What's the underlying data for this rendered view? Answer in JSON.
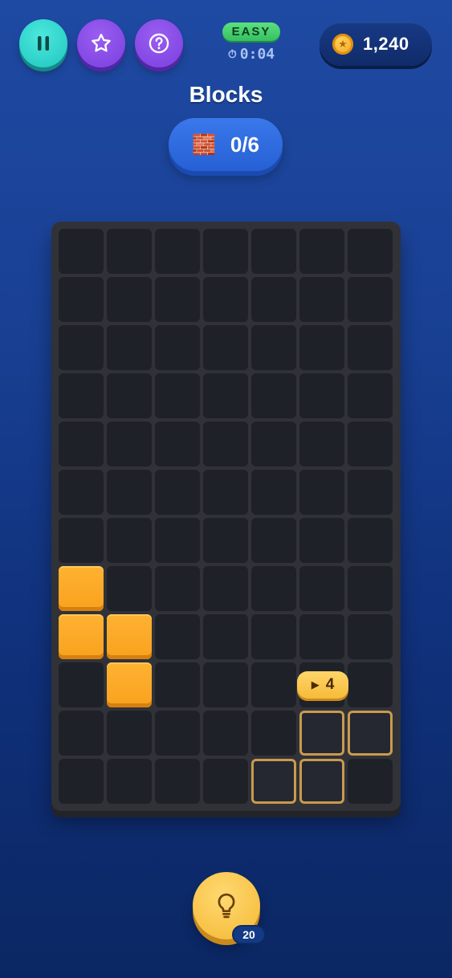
{
  "header": {
    "difficulty": "EASY",
    "timer": "0:04",
    "coins": "1,240"
  },
  "level": {
    "title": "Blocks",
    "progress": "0/6"
  },
  "board": {
    "cols": 7,
    "rows": 12,
    "filled_cells": [
      [
        7,
        0
      ],
      [
        8,
        0
      ],
      [
        8,
        1
      ],
      [
        9,
        1
      ]
    ],
    "target_cells": [
      [
        10,
        5
      ],
      [
        10,
        6
      ],
      [
        11,
        4
      ],
      [
        11,
        5
      ]
    ],
    "target_moves": "4"
  },
  "hint": {
    "count": "20"
  },
  "icons": {
    "pause": "pause-icon",
    "star": "star-icon",
    "help": "help-icon",
    "coin": "coin-icon",
    "brick": "brick-icon",
    "timer": "stopwatch-icon",
    "bulb": "lightbulb-icon",
    "play": "play-icon"
  },
  "colors": {
    "block": "#f7a21e",
    "target_outline": "#c99a4e",
    "difficulty_badge": "#35c062"
  }
}
